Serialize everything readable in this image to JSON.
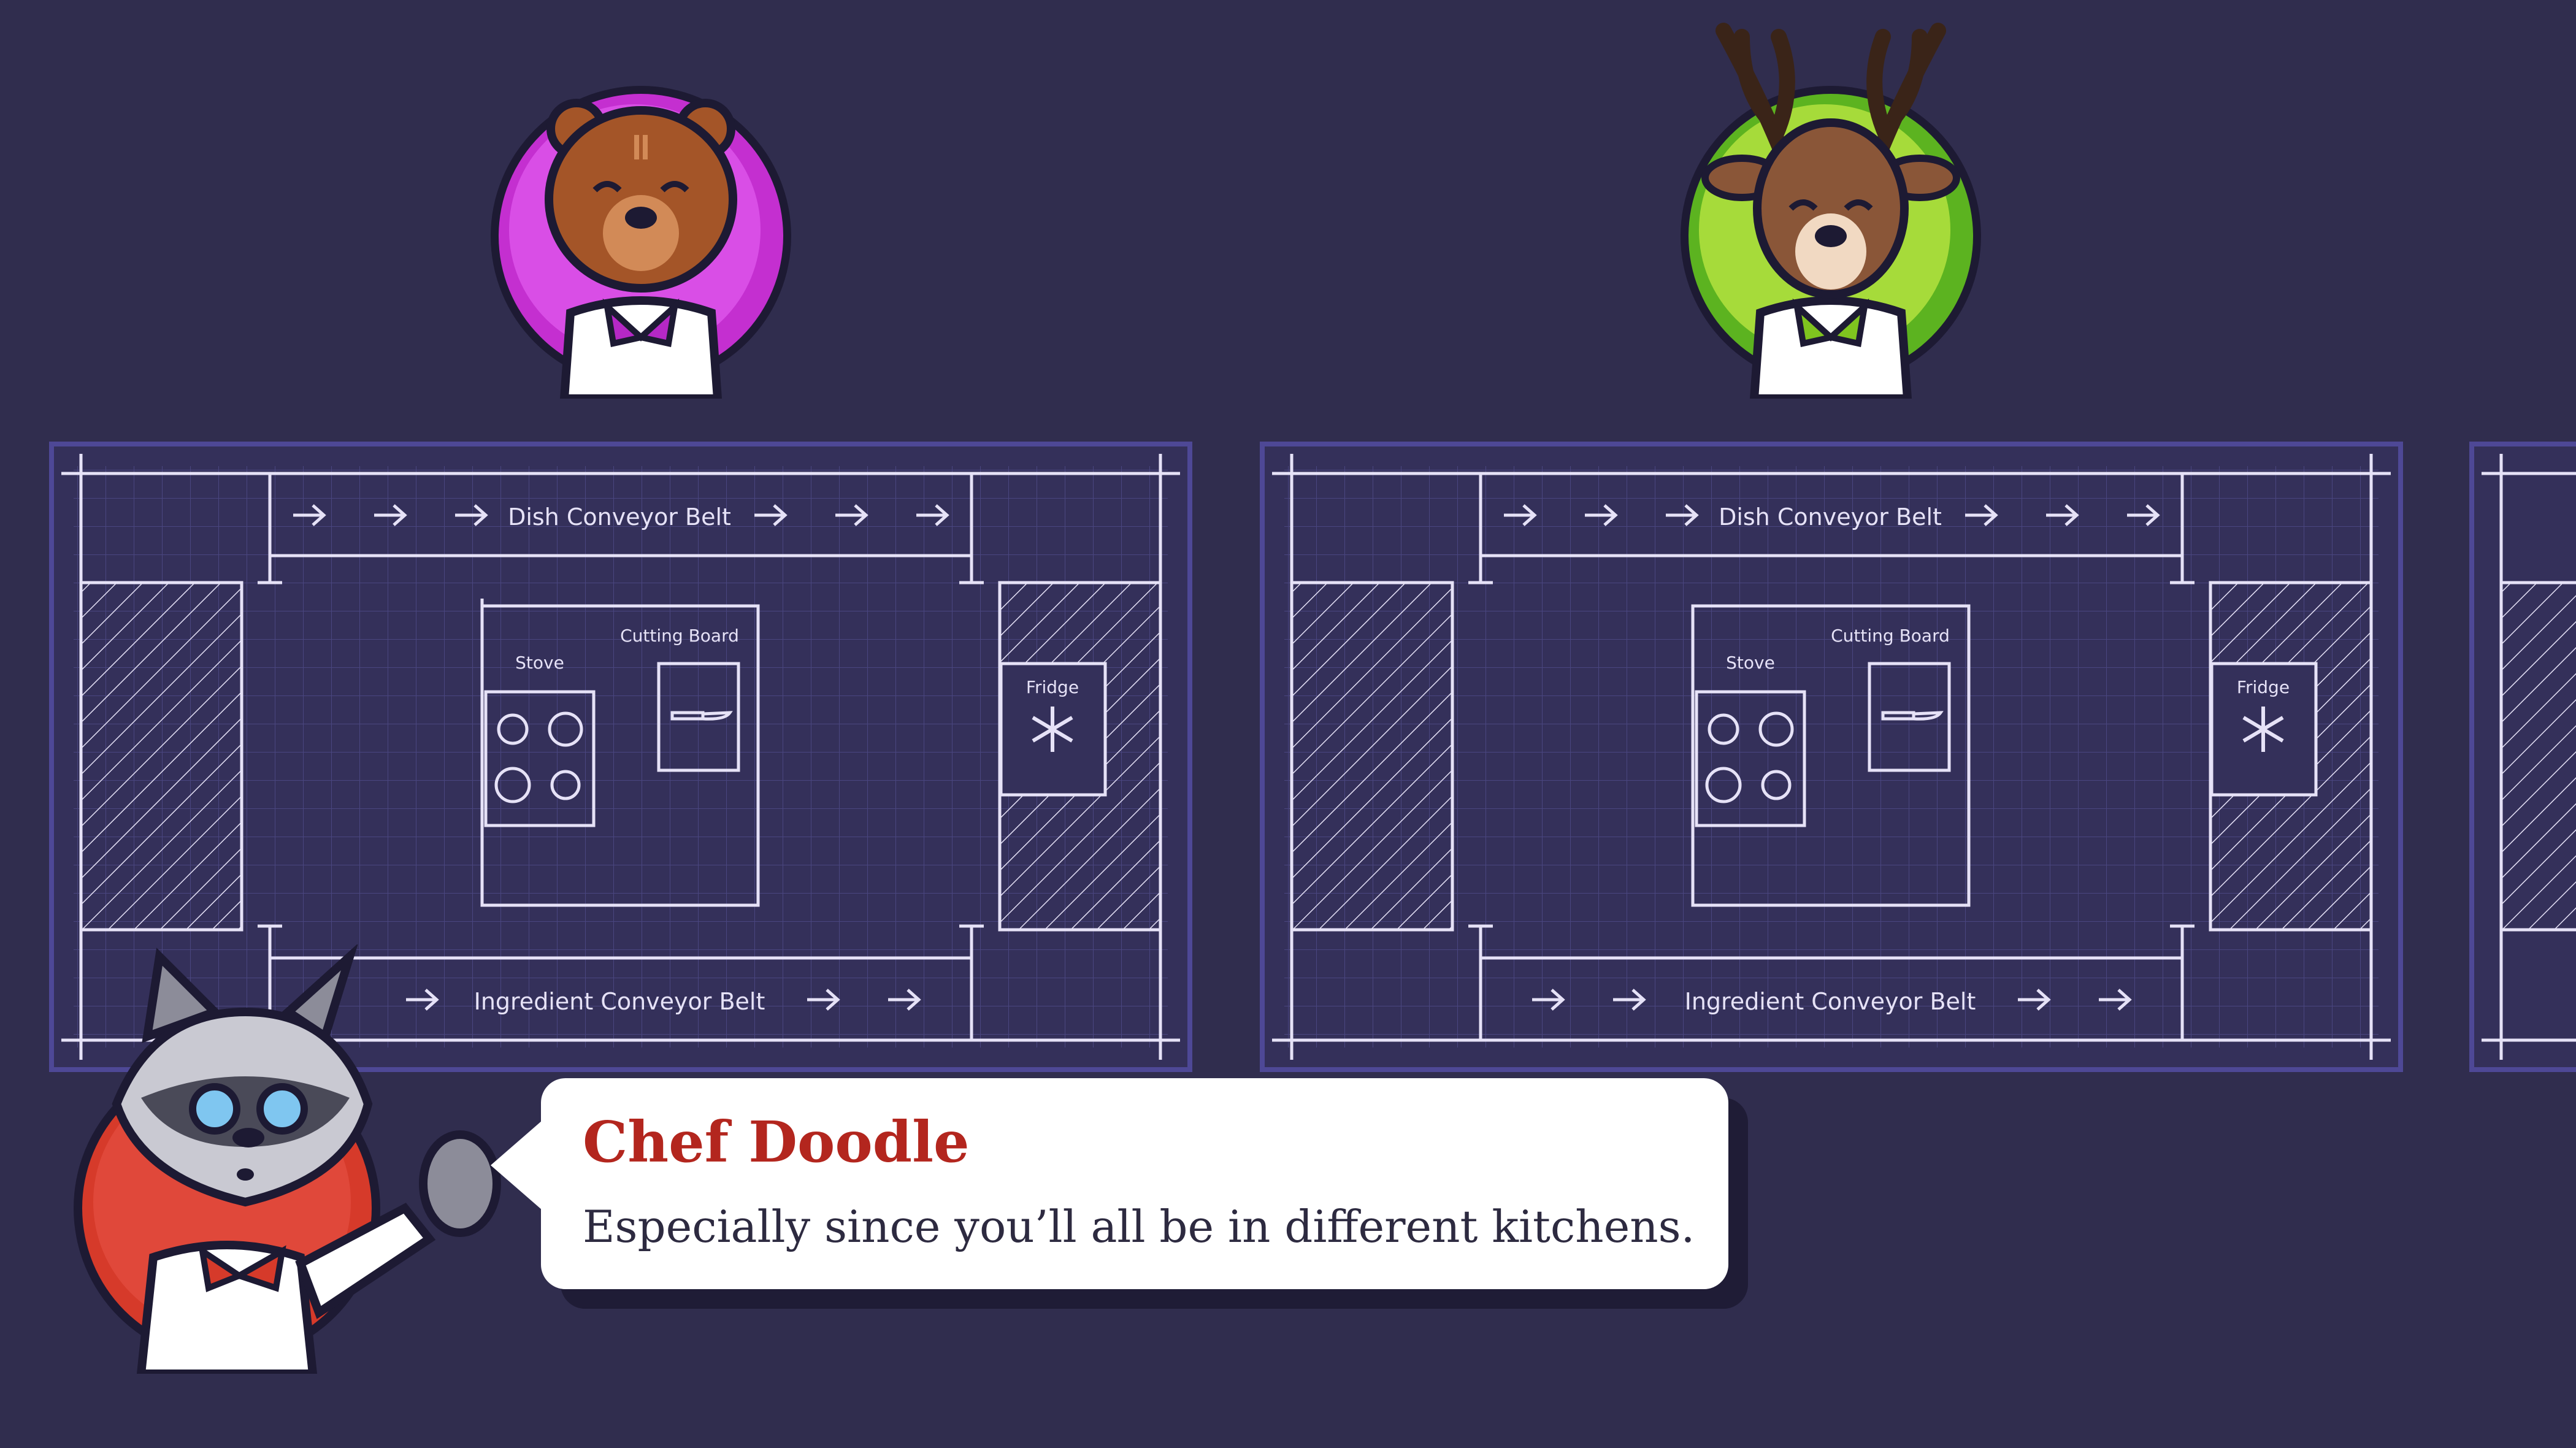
{
  "kitchens": [
    {
      "dish_belt_label": "Dish Conveyor Belt",
      "ingredient_belt_label": "Ingredient Conveyor Belt",
      "stove_label": "Stove",
      "cutting_board_label": "Cutting Board",
      "fridge_label": "Fridge"
    },
    {
      "dish_belt_label": "Dish Conveyor Belt",
      "ingredient_belt_label": "Ingredient Conveyor Belt",
      "stove_label": "Stove",
      "cutting_board_label": "Cutting Board",
      "fridge_label": "Fridge"
    }
  ],
  "players": [
    {
      "character": "bear",
      "ring_color": "#c42fd0"
    },
    {
      "character": "deer",
      "ring_color": "#8ed22f"
    }
  ],
  "dialogue": {
    "speaker": "Chef Doodle",
    "text": "Especially since you’ll all be in different kitchens.",
    "speaker_color": "#b3261e",
    "portrait": "raccoon-chef",
    "portrait_ring_color": "#d63a2a"
  },
  "colors": {
    "background": "#302d4e",
    "blueprint": "#34305a",
    "blueprint_border": "#4e4896",
    "line": "#e6e2f7"
  }
}
